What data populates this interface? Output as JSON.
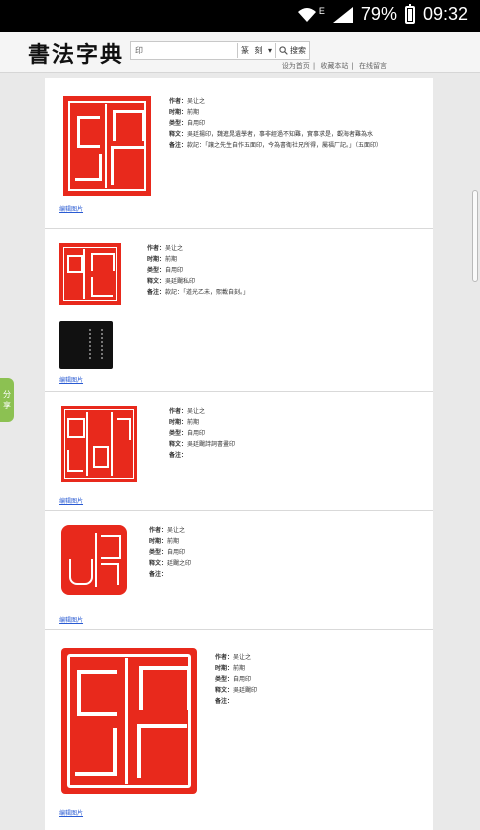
{
  "status": {
    "battery_pct": "79%",
    "time": "09:32",
    "network": "E"
  },
  "header": {
    "logo": "書法字典",
    "search_value": "印",
    "select_label": "篆",
    "select_value": "刻",
    "search_button": "搜索"
  },
  "subnav": [
    "设为首页",
    "收藏本站",
    "在线留言"
  ],
  "side": {
    "share_label": [
      "分",
      "享"
    ]
  },
  "cards": [
    {
      "seal_text": "吳廷陽",
      "author_k": "作者：",
      "author": "吴让之",
      "period_k": "时期：",
      "period": "前期",
      "type_k": "类型：",
      "type": "自用印",
      "text_k": "释文：",
      "text": "吳廷揚印，魏進晁遺學者，事非經過不知難，實事求是，觀海者難為水",
      "note_k": "备注：",
      "note": "款記：「讓之先生自作五面印，今為書衛社兄所得，屬福厂記。」（五面印）",
      "edit": "编辑图片"
    },
    {
      "seal_text": "吳廷颺私印",
      "author_k": "作者：",
      "author": "吴让之",
      "period_k": "时期：",
      "period": "前期",
      "type_k": "类型：",
      "type": "自用印",
      "text_k": "释文：",
      "text": "吳廷颺私印",
      "note_k": "备注：",
      "note": "款記：「道光乙未，熙載自刻。」",
      "edit": "编辑图片"
    },
    {
      "seal_text": "吳廷颺詩詞書畫印",
      "author_k": "作者：",
      "author": "吴让之",
      "period_k": "时期：",
      "period": "前期",
      "type_k": "类型：",
      "type": "自用印",
      "text_k": "释文：",
      "text": "吳廷颺詩詞書畫印",
      "note_k": "备注：",
      "note": "",
      "edit": "编辑图片"
    },
    {
      "seal_text": "廷颺之印",
      "author_k": "作者：",
      "author": "吴让之",
      "period_k": "时期：",
      "period": "前期",
      "type_k": "类型：",
      "type": "自用印",
      "text_k": "释文：",
      "text": "廷颺之印",
      "note_k": "备注：",
      "note": "",
      "edit": "编辑图片"
    },
    {
      "seal_text": "吳廷颺印",
      "author_k": "作者：",
      "author": "吴让之",
      "period_k": "时期：",
      "period": "前期",
      "type_k": "类型：",
      "type": "自用印",
      "text_k": "释文：",
      "text": "吳廷颺印",
      "note_k": "备注：",
      "note": "",
      "edit": "编辑图片"
    }
  ],
  "colors": {
    "seal_red": "#e8291c",
    "share_green": "#8cc152",
    "link_blue": "#2a5bd3"
  }
}
